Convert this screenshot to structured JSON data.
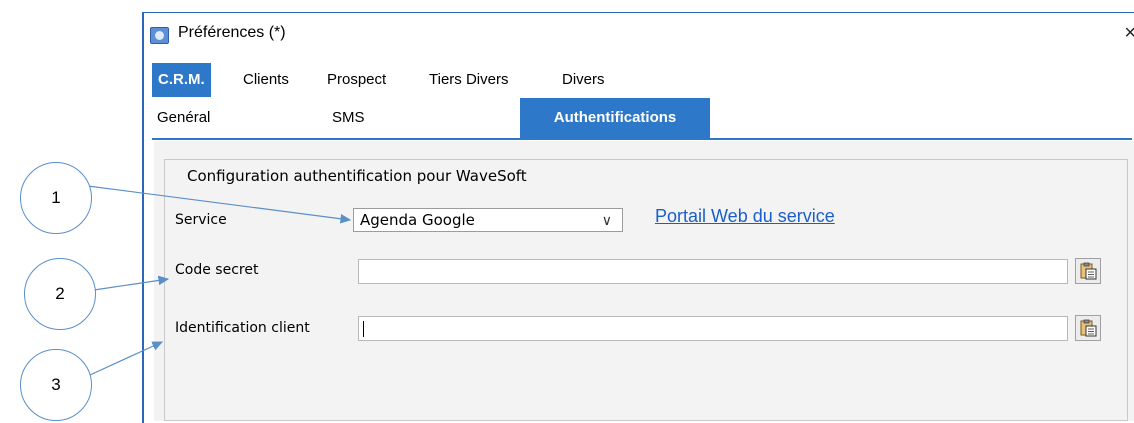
{
  "window": {
    "title": "Préférences (*)",
    "close": "×"
  },
  "tabs_main": [
    {
      "label": "C.R.M.",
      "active": true
    },
    {
      "label": "Clients"
    },
    {
      "label": "Prospect"
    },
    {
      "label": "Tiers Divers"
    },
    {
      "label": "Divers"
    }
  ],
  "tabs_sub": [
    {
      "label": "Genéral"
    },
    {
      "label": "SMS"
    },
    {
      "label": "Authentifications",
      "active": true
    }
  ],
  "group": {
    "legend": "Configuration authentification pour WaveSoft"
  },
  "form": {
    "service_label": "Service",
    "service_value": "Agenda Google",
    "service_link": "Portail Web du service",
    "secret_label": "Code secret",
    "secret_value": "",
    "client_label": "Identification client",
    "client_value": ""
  },
  "callouts": [
    "1",
    "2",
    "3"
  ],
  "colors": {
    "accent": "#2d78c8",
    "link": "#1a5fc8",
    "callout_border": "#5a8fc8"
  }
}
